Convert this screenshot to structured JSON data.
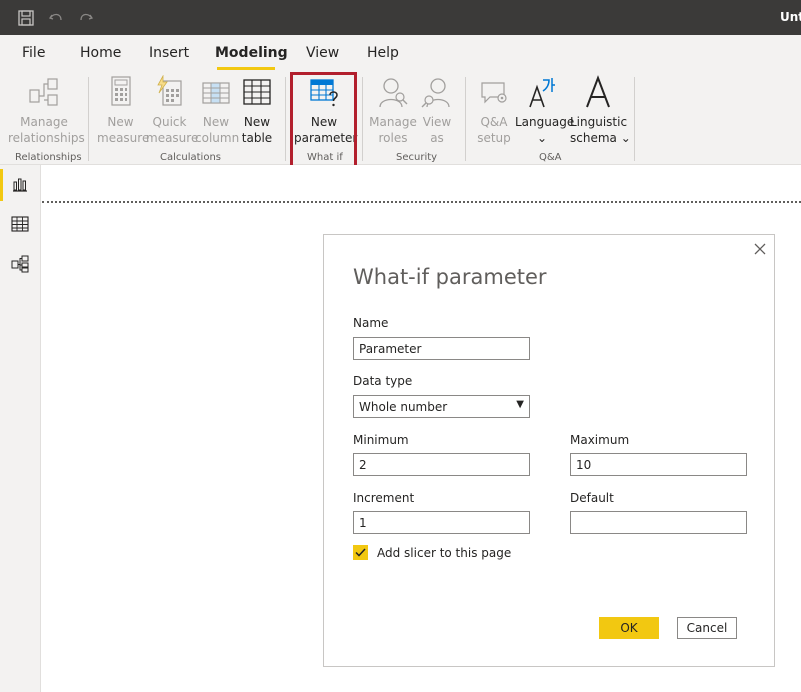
{
  "titlebar": {
    "doc_title": "Unt",
    "save_icon": "save-icon",
    "undo_icon": "undo-icon",
    "redo_icon": "redo-icon"
  },
  "menu": {
    "tabs": [
      {
        "label": "File"
      },
      {
        "label": "Home"
      },
      {
        "label": "Insert"
      },
      {
        "label": "Modeling",
        "active": true
      },
      {
        "label": "View"
      },
      {
        "label": "Help"
      }
    ]
  },
  "ribbon": {
    "groups": {
      "relationships": "Relationships",
      "calculations": "Calculations",
      "whatif": "What if",
      "security": "Security",
      "qa": "Q&A"
    },
    "buttons": {
      "manage_relationships": [
        "Manage",
        "relationships"
      ],
      "new_measure": [
        "New",
        "measure"
      ],
      "quick_measure": [
        "Quick",
        "measure"
      ],
      "new_column": [
        "New",
        "column"
      ],
      "new_table": [
        "New",
        "table"
      ],
      "new_parameter": [
        "New",
        "parameter"
      ],
      "manage_roles": [
        "Manage",
        "roles"
      ],
      "view_as": [
        "View",
        "as"
      ],
      "qa_setup": [
        "Q&A",
        "setup"
      ],
      "language": [
        "Language",
        "⌄"
      ],
      "linguistic_schema": [
        "Linguistic",
        "schema ⌄"
      ]
    }
  },
  "colors": {
    "accent": "#f2c811",
    "highlight": "#b21f2d",
    "titlebar": "#3b3a39",
    "ribbon_bg": "#f3f2f1"
  },
  "leftnav": {
    "items": [
      "report-view-icon",
      "data-view-icon",
      "model-view-icon"
    ]
  },
  "dialog": {
    "title": "What-if parameter",
    "name_label": "Name",
    "name_value": "Parameter",
    "datatype_label": "Data type",
    "datatype_value": "Whole number",
    "minimum_label": "Minimum",
    "minimum_value": "2",
    "maximum_label": "Maximum",
    "maximum_value": "10",
    "increment_label": "Increment",
    "increment_value": "1",
    "default_label": "Default",
    "default_value": "",
    "slicer_label": "Add slicer to this page",
    "slicer_checked": true,
    "ok_label": "OK",
    "cancel_label": "Cancel"
  }
}
